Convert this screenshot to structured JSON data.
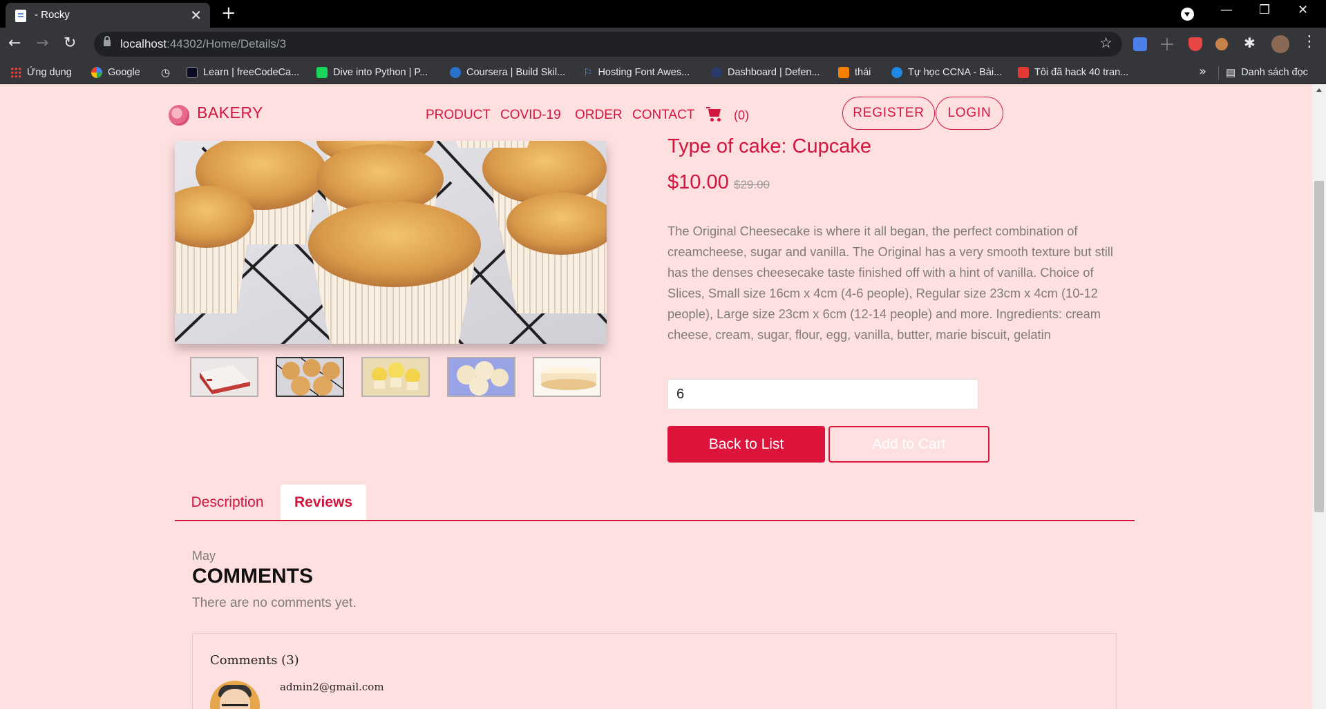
{
  "browser": {
    "tab_title": "- Rocky",
    "url_host": "localhost",
    "url_rest": ":44302/Home/Details/3",
    "bookmarks": [
      {
        "label": "Ứng dụng",
        "color": "#ea4335"
      },
      {
        "label": "Google",
        "color": "#4285f4"
      },
      {
        "label": "",
        "color": "#e8eaed"
      },
      {
        "label": "Learn | freeCodeCa...",
        "color": "#0a0a23"
      },
      {
        "label": "Dive into Python | P...",
        "color": "#19d65a"
      },
      {
        "label": "Coursera | Build Skil...",
        "color": "#2a73cc"
      },
      {
        "label": "Hosting Font Awes...",
        "color": "#538dd7"
      },
      {
        "label": "Dashboard | Defen...",
        "color": "#2b3a6b"
      },
      {
        "label": "thái",
        "color": "#f57d00"
      },
      {
        "label": "Tự học CCNA - Bài...",
        "color": "#1e88e5"
      },
      {
        "label": "Tôi đã hack 40 tran...",
        "color": "#e53935"
      }
    ],
    "reading_list": "Danh sách đọc"
  },
  "navbar": {
    "brand": "BAKERY",
    "links": [
      "PRODUCT",
      "COVID-19",
      "ORDER",
      "CONTACT"
    ],
    "cart_count": "(0)",
    "register": "REGISTER",
    "login": "LOGIN"
  },
  "product": {
    "type_label": "Type of cake: Cupcake",
    "price": "$10.00",
    "old_price": "$29.00",
    "description": "The Original Cheesecake is where it all began, the perfect combination of creamcheese, sugar and vanilla. The Original has a very smooth texture but still has the denses cheesecake taste finished off with a hint of vanilla. Choice of Slices, Small size 16cm x 4cm (4-6 people), Regular size 23cm x 4cm (10-12 people), Large size 23cm x 6cm (12-14 people) and more. Ingredients: cream cheese, cream, sugar, flour, egg, vanilla, butter, marie biscuit, gelatin",
    "quantity": "6",
    "back_button": "Back to List",
    "add_button": "Add to Cart",
    "thumbnails": [
      "red-velvet-cake",
      "cupcakes",
      "lemon-cupcakes",
      "vanilla-muffins",
      "cheesecake"
    ],
    "active_thumbnail": 1
  },
  "tabs": {
    "description": "Description",
    "reviews": "Reviews"
  },
  "reviews": {
    "month": "May",
    "heading": "COMMENTS",
    "empty_text": "There are no comments yet.",
    "comments_count": "Comments (3)",
    "first_user": "admin2@gmail.com"
  }
}
